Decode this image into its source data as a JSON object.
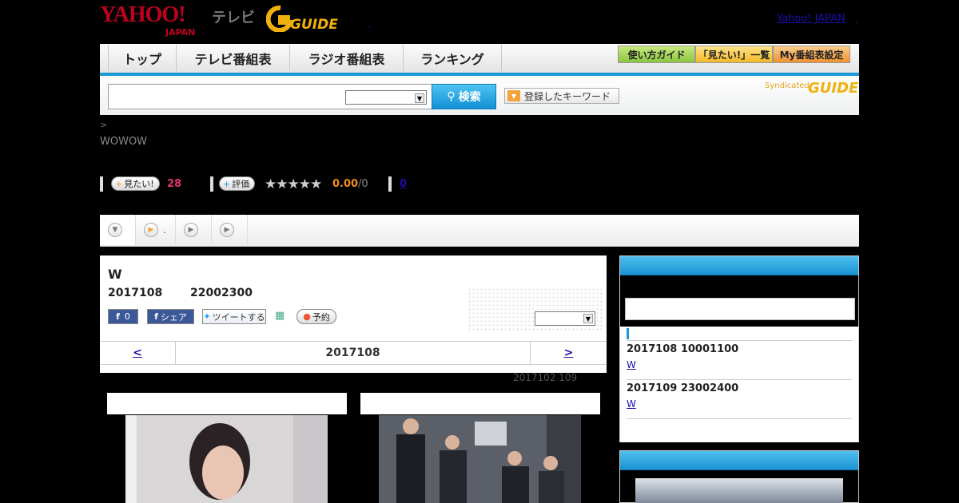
{
  "header": {
    "logo_yahoo": "YAHOO!",
    "logo_japan": "JAPAN",
    "logo_tv": "テレビ",
    "logo_gguide": "GUIDE",
    "yahoo_link": "Yahoo! JAPAN",
    "comma1": ",",
    "comma2": ","
  },
  "nav": {
    "items": [
      {
        "label": "トップ"
      },
      {
        "label": "テレビ番組表"
      },
      {
        "label": "ラジオ番組表"
      },
      {
        "label": "ランキング"
      }
    ],
    "buttons": [
      {
        "label": "使い方ガイド"
      },
      {
        "label": "「見たい!」一覧"
      },
      {
        "label": "My番組表設定"
      }
    ]
  },
  "search": {
    "placeholder": "",
    "button_label": "検索",
    "keyword_label": "登録したキーワード",
    "syndicated": "Syndicated",
    "syndicated_logo": "GUIDE"
  },
  "breadcrumb": ">",
  "channel": "WOWOW",
  "actions": {
    "want_label": "見たい!",
    "want_count": "28",
    "rate_label": "評価",
    "stars": "★★★★★",
    "score": "0.00",
    "score_denom": "/0",
    "link_count": "0"
  },
  "tabs": [
    {
      "label": ""
    },
    {
      "label": "."
    },
    {
      "label": ""
    },
    {
      "label": ""
    }
  ],
  "program": {
    "title": "W",
    "date": "2017108",
    "time": "22002300",
    "fb_count": "0",
    "fb_share": "シェア",
    "tweet": "ツイートする",
    "record": "予約"
  },
  "pager": {
    "prev": "<",
    "current": "2017108",
    "next": ">"
  },
  "updated": "2017102  109",
  "sidebar": {
    "entries": [
      {
        "date": "2017108  10001100",
        "link": "W"
      },
      {
        "date": "2017109  23002400",
        "link": "W"
      }
    ]
  },
  "colors": {
    "accent": "#1a9ad6",
    "pink": "#e2336f",
    "orange": "#ef8e1a"
  }
}
